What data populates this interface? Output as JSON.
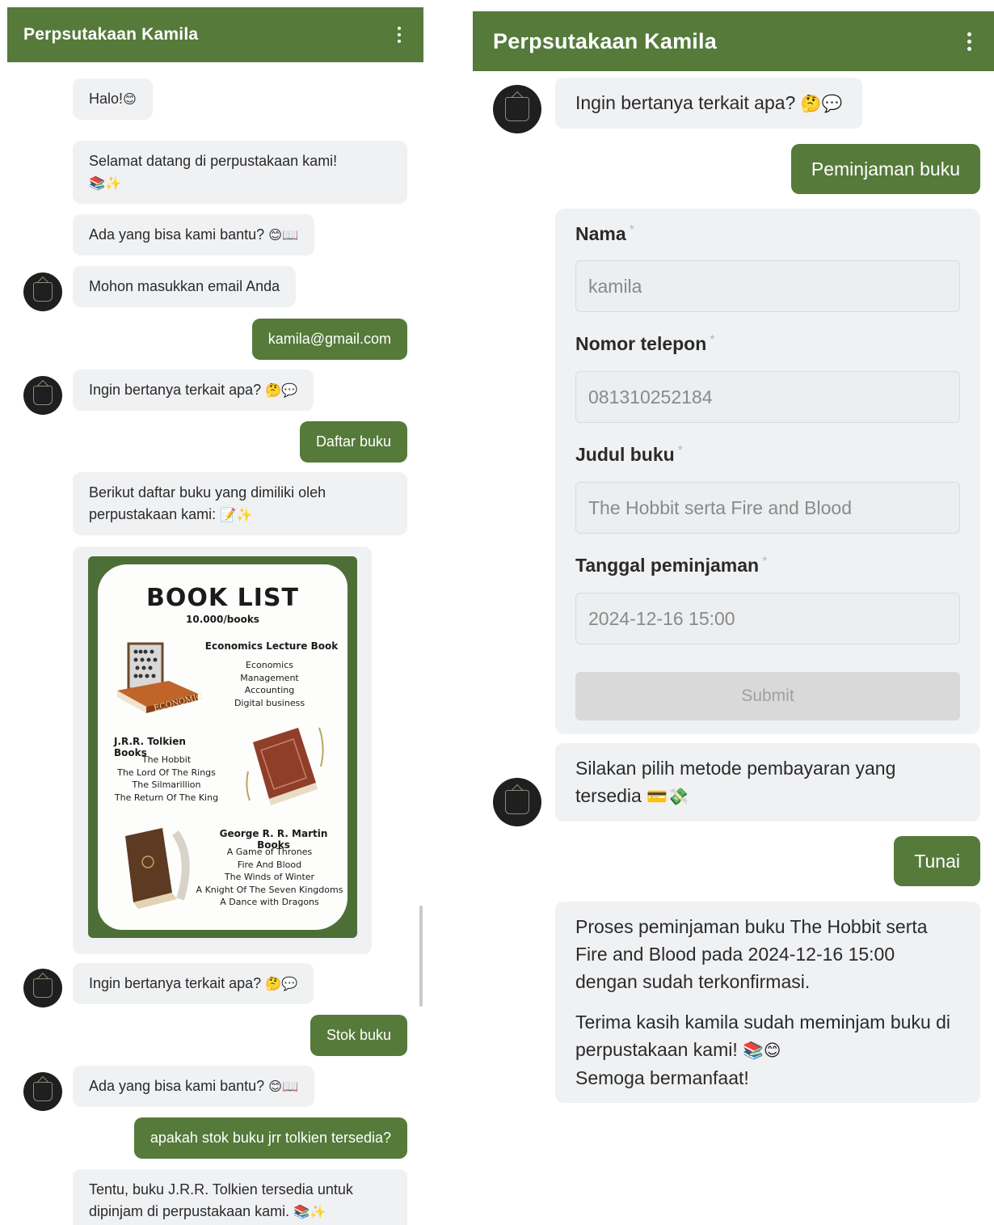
{
  "app": {
    "title": "Perpsutakaan Kamila"
  },
  "left": {
    "messages": [
      {
        "text": "Halo!",
        "emoji": "😊"
      },
      {
        "text": "Selamat datang di perpustakaan kami!",
        "emoji": "📚✨"
      },
      {
        "text": "Ada yang bisa kami bantu?",
        "emoji": "😊📖"
      },
      {
        "text": "Mohon masukkan email Anda",
        "emoji": ""
      },
      {
        "text": "kamila@gmail.com",
        "emoji": ""
      },
      {
        "text": "Ingin bertanya terkait apa?",
        "emoji": "🤔💬"
      },
      {
        "text": "Daftar buku",
        "emoji": ""
      },
      {
        "text": "Berikut daftar buku yang dimiliki oleh perpustakaan kami:",
        "emoji": "📝✨"
      },
      {
        "text": "Ingin bertanya terkait apa?",
        "emoji": "🤔💬"
      },
      {
        "text": "Stok buku",
        "emoji": ""
      },
      {
        "text": "Ada yang bisa kami bantu?",
        "emoji": "😊📖"
      },
      {
        "text": "apakah stok buku jrr tolkien tersedia?",
        "emoji": ""
      },
      {
        "text": "Tentu, buku J.R.R. Tolkien tersedia untuk dipinjam di perpustakaan kami.",
        "emoji": "📚✨"
      }
    ],
    "book_list": {
      "title": "BOOK LIST",
      "subtitle": "10.000/books",
      "sections": [
        {
          "heading": "Economics Lecture Book",
          "items": [
            "Economics",
            "Management",
            "Accounting",
            "Digital business"
          ],
          "image_label": "ECONOMICS"
        },
        {
          "heading": "J.R.R. Tolkien Books",
          "items": [
            "The Hobbit",
            "The Lord Of The Rings",
            "The Silmarillion",
            "The Return Of The King"
          ]
        },
        {
          "heading": "George R. R. Martin Books",
          "items": [
            "A Game of Thrones",
            "Fire And Blood",
            "The Winds of Winter",
            "A Knight Of The Seven Kingdoms",
            "A Dance with Dragons"
          ]
        }
      ]
    }
  },
  "right": {
    "messages": [
      {
        "text": "Ingin bertanya terkait apa?",
        "emoji": "🤔💬"
      },
      {
        "text": "Peminjaman buku",
        "emoji": ""
      },
      {
        "text": "Silakan pilih metode pembayaran yang tersedia",
        "emoji": "💳💸"
      },
      {
        "text": "Tunai",
        "emoji": ""
      },
      {
        "text": "Proses peminjaman buku The Hobbit serta Fire and Blood pada 2024-12-16 15:00 dengan sudah terkonfirmasi.",
        "emoji": ""
      },
      {
        "text": "Terima kasih kamila sudah meminjam buku di perpustakaan kami!",
        "emoji": "📚😊",
        "text2": "Semoga bermanfaat!"
      }
    ],
    "form": {
      "fields": [
        {
          "label": "Nama",
          "required": "*",
          "value": "kamila"
        },
        {
          "label": "Nomor telepon",
          "required": "*",
          "value": "081310252184"
        },
        {
          "label": "Judul buku",
          "required": "*",
          "value": "The Hobbit serta Fire and Blood"
        },
        {
          "label": "Tanggal peminjaman",
          "required": "*",
          "value": "2024-12-16 15:00"
        }
      ],
      "submit_label": "Submit"
    }
  },
  "icons": {
    "menu": "kebab-menu-icon",
    "avatar": "library-logo-icon"
  },
  "colors": {
    "brand_green": "#557a3a",
    "bubble_gray": "#f0f1f3"
  }
}
